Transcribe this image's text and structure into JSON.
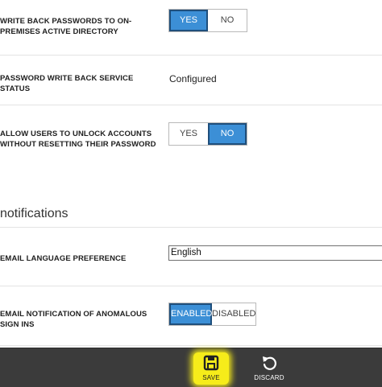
{
  "settings": {
    "write_back": {
      "label": "WRITE BACK PASSWORDS TO ON-PREMISES ACTIVE DIRECTORY",
      "yes": "YES",
      "no": "NO",
      "selected": "YES"
    },
    "service_status": {
      "label": "PASSWORD WRITE BACK SERVICE STATUS",
      "value": "Configured"
    },
    "unlock_accounts": {
      "label": "ALLOW USERS TO UNLOCK ACCOUNTS WITHOUT RESETTING THEIR PASSWORD",
      "yes": "YES",
      "no": "NO",
      "selected": "NO"
    }
  },
  "notifications": {
    "title": "notifications",
    "email_language": {
      "label": "EMAIL LANGUAGE PREFERENCE",
      "value": "English"
    },
    "anomalous_signins": {
      "label": "EMAIL NOTIFICATION OF ANOMALOUS SIGN INS",
      "enabled": "ENABLED",
      "disabled": "DISABLED",
      "selected": "ENABLED"
    }
  },
  "footer": {
    "save_label": "SAVE",
    "discard_label": "DISCARD"
  },
  "colors": {
    "accent": "#3c8fd6",
    "footer_bg": "#3b3b3b",
    "highlight": "#f6ec1a"
  }
}
